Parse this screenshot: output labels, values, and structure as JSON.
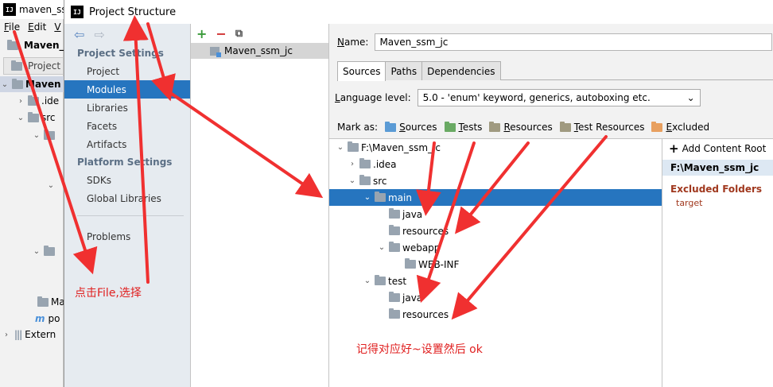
{
  "background_ide": {
    "title": "maven_ssm",
    "logo": "IJ",
    "menu": [
      "File",
      "Edit",
      "V"
    ],
    "nav_project": "Maven_ss",
    "project_tab": "Project",
    "tree": [
      {
        "label": "Maven",
        "expanded": true
      },
      {
        "label": ".ide",
        "expanded": false
      },
      {
        "label": "src",
        "expanded": true
      },
      {
        "label": "Ma"
      },
      {
        "label": "po"
      },
      {
        "label": "Extern"
      }
    ]
  },
  "dialog": {
    "title": "Project Structure",
    "logo": "IJ",
    "nav": {
      "project_settings_header": "Project Settings",
      "project_settings": [
        "Project",
        "Modules",
        "Libraries",
        "Facets",
        "Artifacts"
      ],
      "platform_settings_header": "Platform Settings",
      "platform_settings": [
        "SDKs",
        "Global Libraries"
      ],
      "problems": "Problems",
      "selected": "Modules"
    },
    "module_list": {
      "items": [
        "Maven_ssm_jc"
      ]
    },
    "name_label": "Name:",
    "name_value": "Maven_ssm_jc",
    "tabs": [
      "Sources",
      "Paths",
      "Dependencies"
    ],
    "active_tab": "Sources",
    "language_level_label": "Language level:",
    "language_level_value": "5.0 - 'enum' keyword, generics, autoboxing etc.",
    "mark_as_label": "Mark as:",
    "mark_as": [
      "Sources",
      "Tests",
      "Resources",
      "Test Resources",
      "Excluded"
    ],
    "tree": [
      "F:\\Maven_ssm_jc",
      ".idea",
      "src",
      "main",
      "java",
      "resources",
      "webapp",
      "WEB-INF",
      "test",
      "java",
      "resources"
    ],
    "content_root": {
      "add_label": "Add Content Root",
      "path": "F:\\Maven_ssm_jc",
      "excluded_header": "Excluded Folders",
      "excluded_items": [
        "target"
      ]
    }
  },
  "annotations": {
    "step1": "点击File,选择",
    "step2": "记得对应好~设置然后   ok"
  },
  "colors": {
    "selection": "#2675bf",
    "annotation": "#e02020",
    "excluded": "#a0381e"
  }
}
